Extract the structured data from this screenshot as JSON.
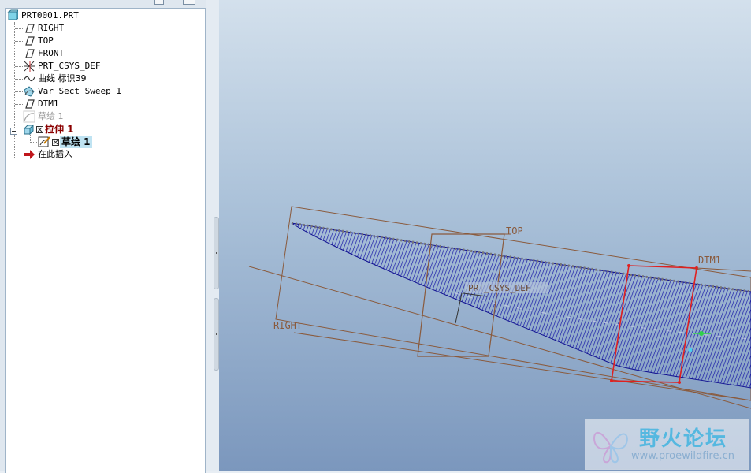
{
  "model_tree": {
    "root": "PRT0001.PRT",
    "items": [
      {
        "label": "RIGHT"
      },
      {
        "label": "TOP"
      },
      {
        "label": "FRONT"
      },
      {
        "label": "PRT_CSYS_DEF"
      },
      {
        "label": "曲线 标识39"
      },
      {
        "label": "Var Sect Sweep 1"
      },
      {
        "label": "DTM1"
      },
      {
        "label": "草绘 1"
      },
      {
        "label": "拉伸 1"
      },
      {
        "label": "草绘 1"
      },
      {
        "label": "在此插入"
      }
    ]
  },
  "viewport": {
    "labels": {
      "top": "TOP",
      "right": "RIGHT",
      "dtm1": "DTM1",
      "csys": "PRT_CSYS_DEF"
    }
  },
  "watermark": {
    "title": "野火论坛",
    "url": "www.proewildfire.cn"
  },
  "colors": {
    "surface_mesh": "#1a1aa8",
    "datum_plane": "#8a5a3c",
    "sketch_plane": "#e02020",
    "selection_highlight": "#bfe3f2",
    "feature_text": "#8b0000"
  }
}
